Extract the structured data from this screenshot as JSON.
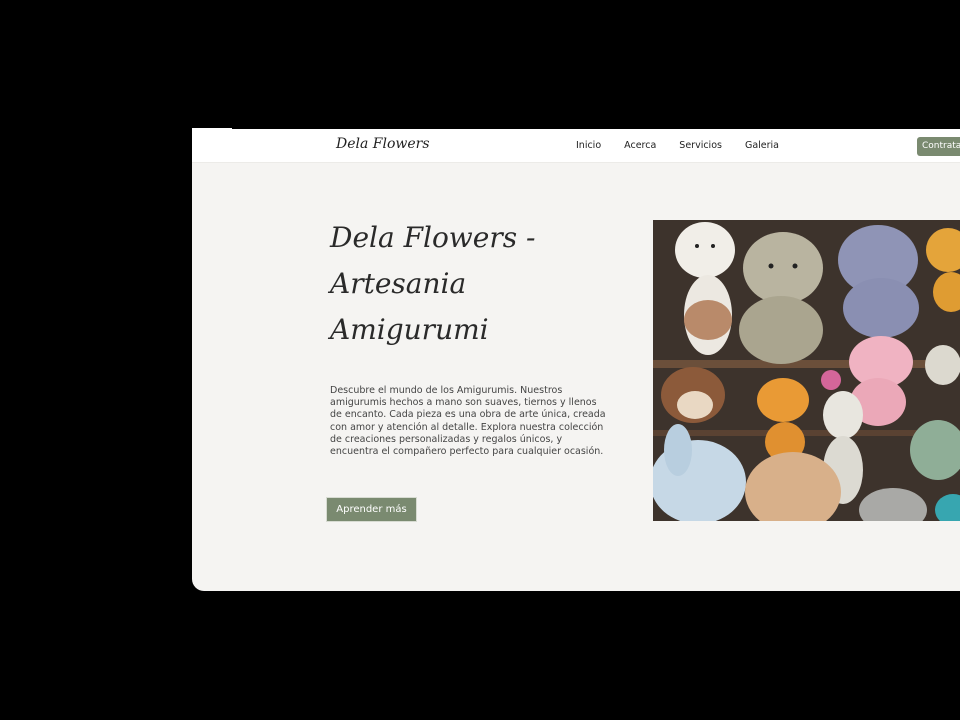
{
  "navbar": {
    "brand": "Dela Flowers",
    "links": [
      "Inicio",
      "Acerca",
      "Servicios",
      "Galeria"
    ],
    "cta_label": "Contratar"
  },
  "hero": {
    "title": "Dela Flowers - Artesania Amigurumi",
    "description": "Descubre el mundo de los Amigurumis. Nuestros amigurumis hechos a mano son suaves, tiernos y llenos de encanto. Cada pieza es una obra de arte única, creada con amor y atención al detalle. Explora nuestra colección de creaciones personalizadas y regalos únicos, y encuentra el compañero perfecto para cualquier ocasión.",
    "button_label": "Aprender más",
    "image_icon": "amigurumi-photo"
  },
  "colors": {
    "accent": "#7a8a70",
    "background": "#f5f4f2",
    "frame": "#000000"
  }
}
